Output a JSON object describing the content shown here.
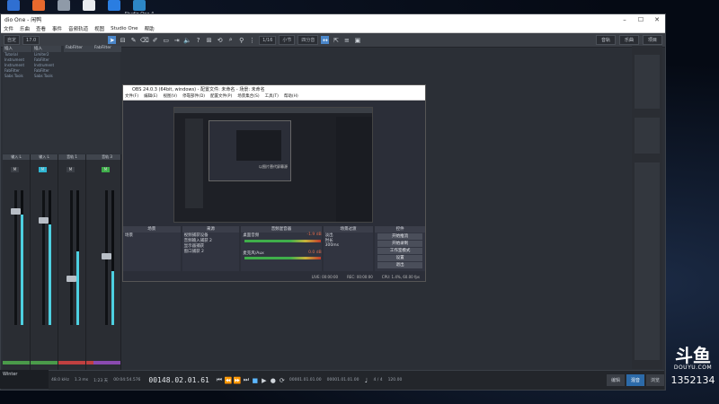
{
  "desktop": {
    "icons": [
      {
        "label": "",
        "color": "#2f6fd1"
      },
      {
        "label": "",
        "color": "#e8692d"
      },
      {
        "label": "",
        "color": "#8f9aa8"
      },
      {
        "label": "",
        "color": "#e9ecf0"
      },
      {
        "label": "",
        "color": "#2a7de1"
      },
      {
        "label": "Studio One 4",
        "color": "#2d86c5"
      }
    ]
  },
  "studio_one": {
    "title": "dio One - 闲鸭",
    "menu": [
      "文件",
      "乐曲",
      "查看",
      "事件",
      "音频轨道",
      "视图",
      "Studio One",
      "帮助"
    ],
    "toolbar": {
      "left_field_1": "自定",
      "left_field_2": "17.0",
      "quantize": "1/16",
      "timebase": "小节",
      "snap": "四分音",
      "right_buttons": [
        "音轨",
        "乐曲",
        "项目"
      ]
    },
    "browser_cols": [
      {
        "head": "插入",
        "items": [
          "Tutorial",
          "Instrument",
          "Instrument",
          "FabFilter",
          "Sabs Tools"
        ]
      },
      {
        "head": "插入",
        "items": [
          "Limiter2",
          "FabFilter",
          "Instrument",
          "FabFilter",
          "Sabs Tools"
        ]
      },
      {
        "head": "FabFilter",
        "items": []
      },
      {
        "head": "FabFilter",
        "items": []
      }
    ],
    "strips": [
      {
        "name": "输入 L",
        "level": 0.82,
        "color": "#4a9a4a"
      },
      {
        "name": "输入 L",
        "level": 0.75,
        "color": "#4a9a4a"
      },
      {
        "name": "音轨 1",
        "level": 0.55,
        "color": "#c04040"
      },
      {
        "name": "音轨 2",
        "level": 0.6,
        "color": "#c04040"
      },
      {
        "name": "音轨 3",
        "level": 0.4,
        "color": "#8a4ab0"
      }
    ],
    "transport": {
      "sample_rate": "48.0 kHz",
      "latency": "1.3 ms",
      "record_time": "1:23 天",
      "record_time2": "00:04:54.576",
      "position": "00148.02.01.61",
      "left_locator": "00001.01.01.00",
      "right_locator": "00001.01.01.00",
      "time_sig": "4 / 4",
      "tempo": "120.00",
      "tempo_label": "速度",
      "modes": [
        "编辑",
        "混音",
        "浏览"
      ]
    },
    "taskbar_label": "Winter",
    "sub_label": "评论 播放"
  },
  "obs": {
    "title": "OBS 24.0.3 (64bit, windows) - 配置文件: 未命名 - 场景: 未命名",
    "menu": [
      "文件(F)",
      "编辑(E)",
      "视图(V)",
      "停靠部件(D)",
      "配置文件(P)",
      "场景集合(S)",
      "工具(T)",
      "帮助(H)"
    ],
    "docks": {
      "scenes": {
        "head": "场景",
        "items": [
          "场景"
        ]
      },
      "sources": {
        "head": "来源",
        "items": [
          "视频捕获设备",
          "音频输入捕获 2",
          "显示器捕获",
          "窗口捕获 2"
        ]
      },
      "mixer": {
        "head": "音频混音器",
        "items": [
          "桌面音频",
          "麦克风/Aux"
        ],
        "values": [
          "-1.9 dB",
          "0.0 dB"
        ]
      },
      "transitions": {
        "head": "场景过渡",
        "items": [
          "淡出",
          "时长",
          "300ms"
        ]
      },
      "controls": {
        "head": "控件",
        "buttons": [
          "开始推流",
          "开始录制",
          "工作室模式",
          "设置",
          "退出"
        ]
      }
    },
    "status": {
      "live": "LIVE: 00:00:00",
      "rec": "REC: 00:00:00",
      "cpu": "CPU: 1.4%, 60.00 fps"
    },
    "nested_caption": "以图片替代屏幕源"
  },
  "watermark": {
    "brand": "DOUYU.COM",
    "room": "1352134"
  }
}
